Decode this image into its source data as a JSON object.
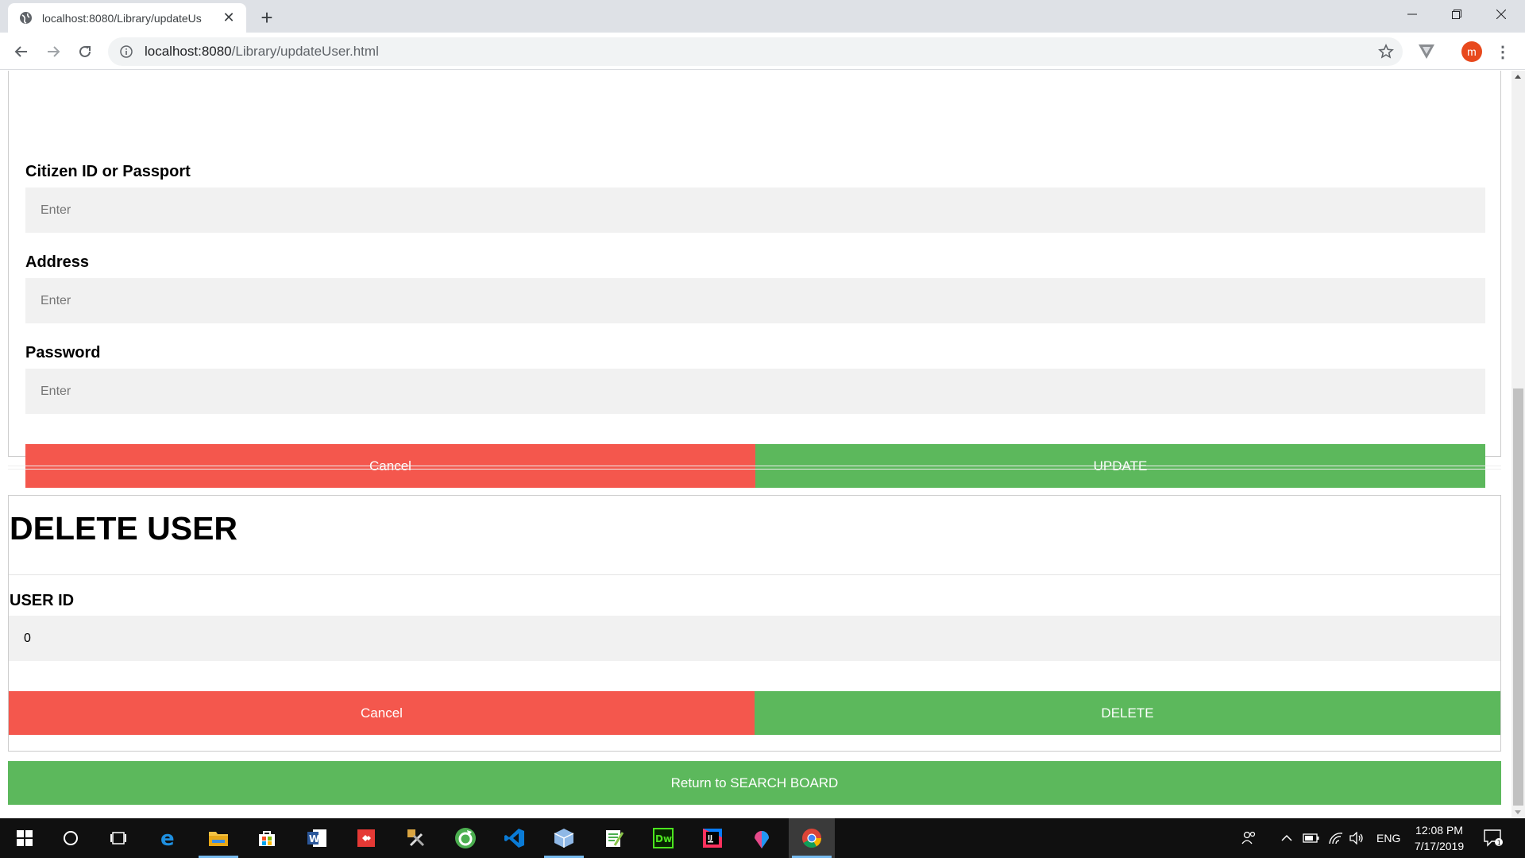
{
  "browser": {
    "tab_title": "localhost:8080/Library/updateUs",
    "url_host": "localhost:8080",
    "url_path": "/Library/updateUser.html",
    "avatar_letter": "m"
  },
  "update_form": {
    "fields": [
      {
        "label": "Citizen ID or Passport",
        "placeholder": "Enter",
        "value": ""
      },
      {
        "label": "Address",
        "placeholder": "Enter",
        "value": ""
      },
      {
        "label": "Password",
        "placeholder": "Enter",
        "value": ""
      }
    ],
    "cancel_label": "Cancel",
    "update_label": "UPDATE"
  },
  "delete_form": {
    "title": "DELETE USER",
    "user_id_label": "USER ID",
    "user_id_value": "0",
    "cancel_label": "Cancel",
    "delete_label": "DELETE"
  },
  "return_label": "Return to SEARCH BOARD",
  "taskbar": {
    "language": "ENG",
    "time": "12:08 PM",
    "date": "7/17/2019",
    "notification_count": "1"
  },
  "colors": {
    "cancel": "#f4574d",
    "confirm": "#5cb85c",
    "input_bg": "#f1f1f1"
  }
}
